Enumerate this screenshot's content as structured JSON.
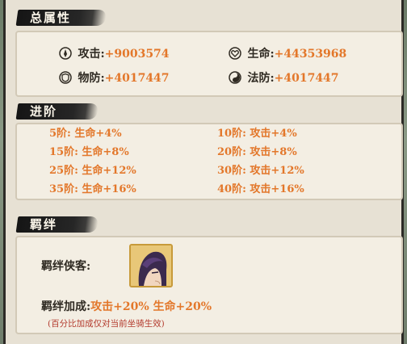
{
  "colors": {
    "accent_orange": "#e3772a",
    "label_dark": "#2f2a22",
    "note_red": "#b3392c",
    "panel_bg": "#f3eee3",
    "header_ink": "#1b1b1b"
  },
  "total_attributes": {
    "title": "总属性",
    "stats": [
      {
        "icon": "attack-icon",
        "label": "攻击:",
        "value": "+9003574"
      },
      {
        "icon": "life-icon",
        "label": "生命:",
        "value": "+44353968"
      },
      {
        "icon": "physical-defense-icon",
        "label": "物防:",
        "value": "+4017447"
      },
      {
        "icon": "magic-defense-icon",
        "label": "法防:",
        "value": "+4017447"
      }
    ]
  },
  "advancement": {
    "title": "进阶",
    "rows": [
      [
        "5阶: 生命+4%",
        "10阶: 攻击+4%"
      ],
      [
        "15阶: 生命+8%",
        "20阶: 攻击+8%"
      ],
      [
        "25阶: 生命+12%",
        "30阶: 攻击+12%"
      ],
      [
        "35阶: 生命+16%",
        "40阶: 攻击+16%"
      ]
    ]
  },
  "bond": {
    "title": "羁绊",
    "hero_label": "羁绊侠客:",
    "avatar_icon": "hero-portrait-icon",
    "bonus_label": "羁绊加成:",
    "bonus_value": "攻击+20% 生命+20%",
    "note": "(百分比加成仅对当前坐骑生效)"
  }
}
